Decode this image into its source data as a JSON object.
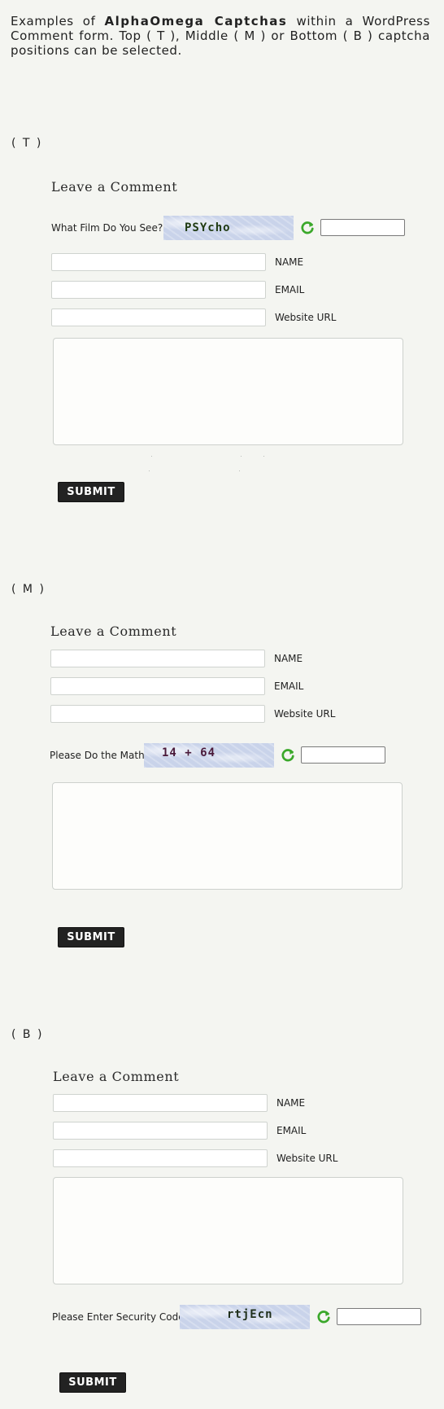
{
  "intro": {
    "prefix": "Examples of ",
    "brand": "AlphaOmega Captchas",
    "suffix": " within a WordPress Comment form. Top ( T ), Middle ( M ) or Bottom ( B ) captcha positions can be selected."
  },
  "sections": [
    {
      "label": "( T )",
      "form": {
        "title": "Leave a Comment",
        "captcha": {
          "prompt": "What Film Do You See?",
          "image_text": "PSYcho",
          "text_color": "#1f3a12",
          "refresh_icon": "refresh-icon"
        },
        "fields": [
          {
            "label": "NAME",
            "value": ""
          },
          {
            "label": "EMAIL",
            "value": ""
          },
          {
            "label": "Website URL",
            "value": ""
          }
        ],
        "comment_value": "",
        "submit_label": "SUBMIT"
      }
    },
    {
      "label": "( M )",
      "form": {
        "title": "Leave a Comment",
        "fields": [
          {
            "label": "NAME",
            "value": ""
          },
          {
            "label": "EMAIL",
            "value": ""
          },
          {
            "label": "Website URL",
            "value": ""
          }
        ],
        "captcha": {
          "prompt": "Please Do the Math",
          "image_text": "14 + 64",
          "text_color": "#4a1a3a",
          "refresh_icon": "refresh-icon"
        },
        "comment_value": "",
        "submit_label": "SUBMIT"
      }
    },
    {
      "label": "( B )",
      "form": {
        "title": "Leave a Comment",
        "fields": [
          {
            "label": "NAME",
            "value": ""
          },
          {
            "label": "EMAIL",
            "value": ""
          },
          {
            "label": "Website URL",
            "value": ""
          }
        ],
        "comment_value": "",
        "captcha": {
          "prompt": "Please Enter Security Code",
          "image_text": "rtjEcn",
          "text_color": "#1f2f1a",
          "refresh_icon": "refresh-icon"
        },
        "submit_label": "SUBMIT"
      }
    }
  ],
  "colors": {
    "background": "#f4f5f1",
    "captcha_background": "#c9d3ea",
    "refresh_icon": "#3aa82a",
    "submit_background": "#222222"
  }
}
